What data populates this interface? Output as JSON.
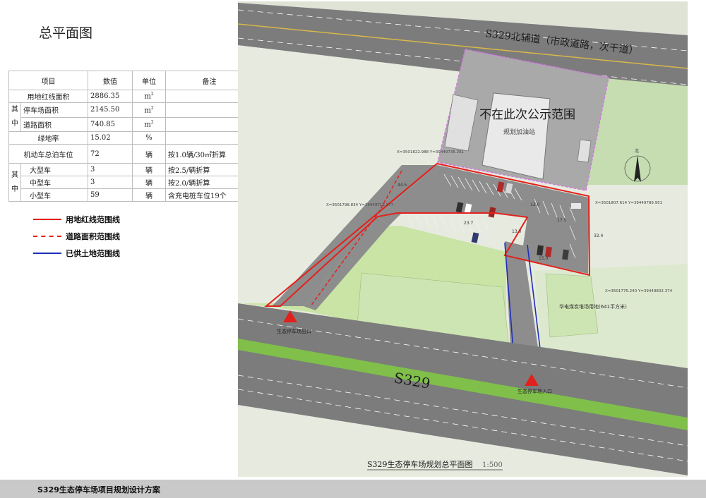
{
  "page_title": "总平面图",
  "table": {
    "headers": [
      "项目",
      "数值",
      "单位",
      "备注"
    ],
    "rows": {
      "land_area": {
        "label": "用地红线面积",
        "value": "2886.35",
        "unit": "m",
        "sup": "2",
        "note": ""
      },
      "parking_area": {
        "label": "停车场面积",
        "value": "2145.50",
        "unit": "m",
        "sup": "2",
        "note": ""
      },
      "road_area": {
        "label": "道路面积",
        "value": "740.85",
        "unit": "m",
        "sup": "2",
        "note": ""
      },
      "green_rate": {
        "label": "绿地率",
        "value": "15.02",
        "unit": "%",
        "note": ""
      },
      "total_spaces": {
        "label": "机动车总泊车位",
        "value": "72",
        "unit": "辆",
        "note": "按1.0辆/30㎡折算"
      },
      "large": {
        "label": "大型车",
        "value": "3",
        "unit": "辆",
        "note": "按2.5/辆折算"
      },
      "medium": {
        "label": "中型车",
        "value": "3",
        "unit": "辆",
        "note": "按2.0/辆折算"
      },
      "small": {
        "label": "小型车",
        "value": "59",
        "unit": "辆",
        "note": "含充电桩车位19个"
      }
    },
    "group_labels": {
      "of_which_1": "其中",
      "of_which_2": "其中"
    }
  },
  "legend": [
    {
      "label": "用地红线范围线",
      "color": "#e3211c",
      "style": "solid"
    },
    {
      "label": "道路面积范围线",
      "color": "#e3211c",
      "style": "dashed"
    },
    {
      "label": "已供土地范围线",
      "color": "#1f2fb8",
      "style": "solid"
    }
  ],
  "map": {
    "north_road_label": "S329北辅道（市政道路，次干道）",
    "main_road_label": "S329",
    "excluded_area_label": "不在此次公示范围",
    "gas_station_label": "规划加油站",
    "exit_label": "生态停车场出口",
    "entrance_label": "生态停车场入口",
    "land_use_note": "华电煤炭堆场用地(641平方米)",
    "plan_caption": "S329生态停车场规划总平面图",
    "plan_scale": "1:500",
    "north_label": "北",
    "coord_labels": [
      "X=3501822.988 Y=39449735.261",
      "X=3501798.834 Y=39449713.377",
      "X=3501807.614 Y=39449789.951",
      "X=3501775.240 Y=39449802.374"
    ],
    "dimension_labels": [
      "44.5",
      "12.0",
      "23.7",
      "17.5",
      "32.4",
      "13.0",
      "15.0"
    ]
  },
  "footer": {
    "title": "S329生态停车场项目规划设计方案"
  },
  "colors": {
    "road": "#7c7c7c",
    "lawn": "#c9e4a4",
    "green_belt": "#7fbf4a",
    "boundary_red": "#e3211c",
    "boundary_blue": "#1f2fb8",
    "excluded_area": "#a9a9a9"
  }
}
